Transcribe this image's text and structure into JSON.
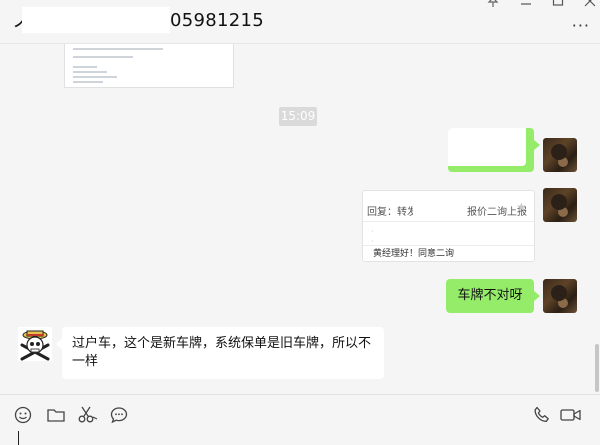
{
  "header": {
    "title_prefix": "ノ",
    "title_suffix": "05981215",
    "pin_icon": "pin-icon",
    "minimize_icon": "minimize-icon",
    "maximize_icon": "maximize-icon",
    "close_icon": "close-icon",
    "more_icon": "more-icon",
    "more_label": "···"
  },
  "chat": {
    "timestamp": "15:09",
    "email_card": {
      "subject_prefix": "回复：转发:",
      "subject_suffix": "报价二询上报",
      "footer_text": "黄经理好！同意二询"
    },
    "messages": [
      {
        "sender": "self",
        "text": "车牌不对呀"
      },
      {
        "sender": "other",
        "text": "过户车，这个是新车牌，系统保单是旧车牌，所以不一样"
      }
    ]
  },
  "toolbar": {
    "icons": [
      "emoji-icon",
      "folder-icon",
      "scissors-icon",
      "chat-bubble-icon",
      "phone-icon",
      "video-call-icon"
    ]
  },
  "colors": {
    "self_bubble": "#95ec69",
    "other_bubble": "#ffffff",
    "background": "#f5f5f5"
  }
}
